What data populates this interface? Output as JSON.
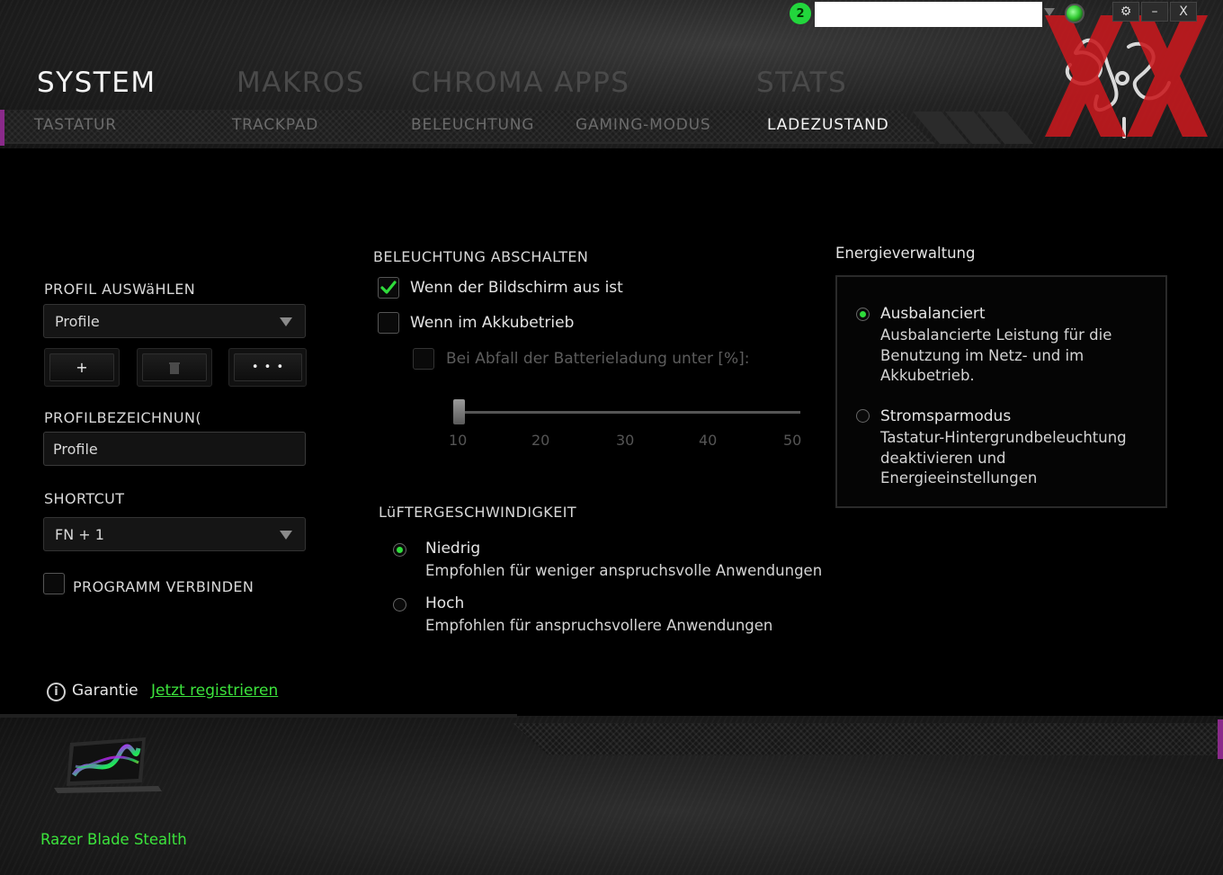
{
  "top_bar": {
    "notification_count": "2",
    "account_value": "",
    "settings_icon": "gear-icon",
    "minimize_label": "–",
    "close_label": "X"
  },
  "main_tabs": [
    {
      "label": "SYSTEM",
      "active": true
    },
    {
      "label": "MAKROS",
      "active": false
    },
    {
      "label": "CHROMA APPS",
      "active": false
    },
    {
      "label": "STATS",
      "active": false
    }
  ],
  "sub_tabs": [
    {
      "label": "TASTATUR",
      "active": false
    },
    {
      "label": "TRACKPAD",
      "active": false
    },
    {
      "label": "BELEUCHTUNG",
      "active": false
    },
    {
      "label": "GAMING-MODUS",
      "active": false
    },
    {
      "label": "LADEZUSTAND",
      "active": true
    }
  ],
  "profile": {
    "select_label": "PROFIL AUSWäHLEN",
    "selected_profile": "Profile",
    "add_label": "+",
    "delete_icon": "trash-icon",
    "more_label": "• • •",
    "name_label": "PROFILBEZEICHNUN(",
    "name_value": "Profile",
    "shortcut_label": "SHORTCUT",
    "shortcut_value": "FN + 1",
    "link_program_label": "PROGRAMM VERBINDEN",
    "link_program_checked": false
  },
  "lighting_off": {
    "title": "BELEUCHTUNG ABSCHALTEN",
    "screen_off_label": "Wenn der Bildschirm aus ist",
    "screen_off_checked": true,
    "battery_label": "Wenn im Akkubetrieb",
    "battery_checked": false,
    "battery_level_label": "Bei Abfall der Batterieladung unter [%]:",
    "battery_level_checked": false,
    "slider_value": 10,
    "slider_ticks": [
      "10",
      "20",
      "30",
      "40",
      "50"
    ]
  },
  "fan_speed": {
    "title": "LüFTERGESCHWINDIGKEIT",
    "options": [
      {
        "label": "Niedrig",
        "desc": "Empfohlen für weniger anspruchsvolle Anwendungen",
        "checked": true
      },
      {
        "label": "Hoch",
        "desc": "Empfohlen für anspruchsvollere Anwendungen",
        "checked": false
      }
    ]
  },
  "energy": {
    "title": "Energieverwaltung",
    "options": [
      {
        "label": "Ausbalanciert",
        "desc": "Ausbalancierte Leistung für die Benutzung im Netz- und im Akkubetrieb.",
        "checked": true
      },
      {
        "label": "Stromsparmodus",
        "desc": "Tastatur-Hintergrundbeleuchtung deaktivieren und Energieeinstellungen",
        "checked": false
      }
    ]
  },
  "warranty": {
    "label": "Garantie",
    "register_link": "Jetzt registrieren"
  },
  "device": {
    "name": "Razer Blade Stealth"
  },
  "colors": {
    "accent_green": "#3ce33c",
    "watermark_red": "#c8191e",
    "purple_edge": "#8a2a8a"
  }
}
